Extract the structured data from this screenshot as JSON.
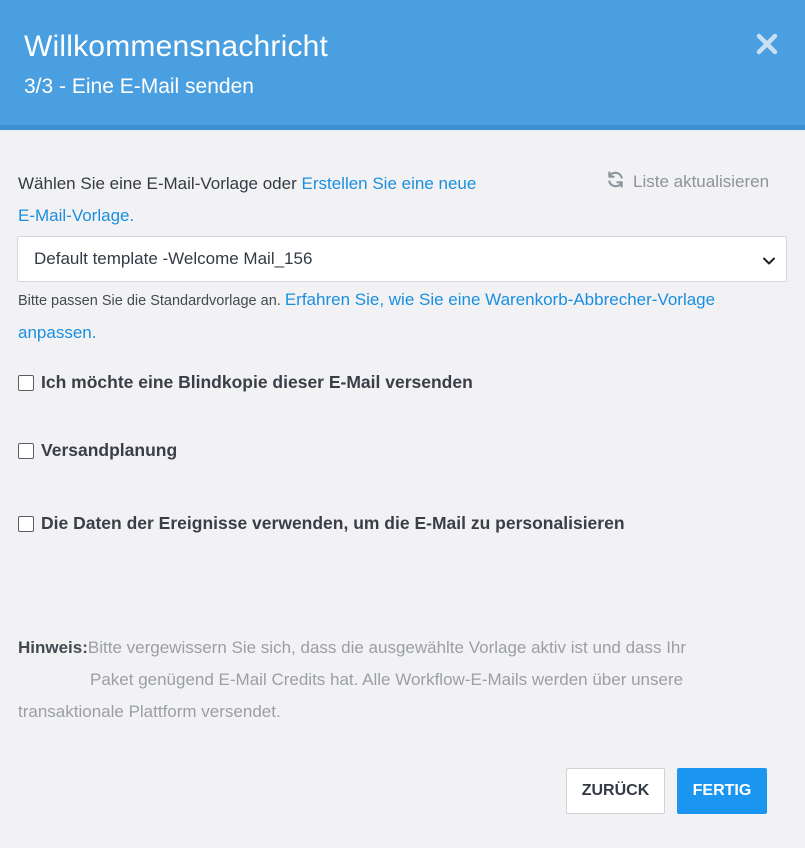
{
  "header": {
    "title": "Willkommensnachricht",
    "subtitle": "3/3 - Eine E-Mail senden",
    "close_icon": "close-icon"
  },
  "template": {
    "prompt_text": "Wählen Sie eine E-Mail-Vorlage oder ",
    "create_link": "Erstellen Sie eine neue E-Mail-Vorlage.",
    "refresh_label": "Liste aktualisieren",
    "refresh_icon": "refresh-icon",
    "selected_value": "Default template -Welcome Mail_156",
    "hint_text": "Bitte passen Sie die Standardvorlage an. ",
    "hint_link": "Erfahren Sie, wie Sie eine Warenkorb-Abbrecher-Vorlage anpassen."
  },
  "options": [
    {
      "label": "Ich möchte eine Blindkopie dieser E-Mail versenden",
      "checked": false
    },
    {
      "label": "Versandplanung",
      "checked": false
    },
    {
      "label": "Die Daten der Ereignisse verwenden, um die E-Mail zu personalisieren",
      "checked": false
    }
  ],
  "note": {
    "label": "Hinweis:",
    "text_line1": "Bitte vergewissern Sie sich, dass die ausgewählte Vorlage aktiv ist und dass Ihr",
    "text_line2": "Paket genügend E-Mail Credits hat. Alle Workflow-E-Mails werden über unsere",
    "text_line3": "transaktionale Plattform versendet."
  },
  "buttons": {
    "back_label": "ZURÜCK",
    "done_label": "FERTIG"
  },
  "colors": {
    "header_bg": "#4a9fe0",
    "accent": "#1a96f0",
    "link": "#1a8fe0"
  }
}
